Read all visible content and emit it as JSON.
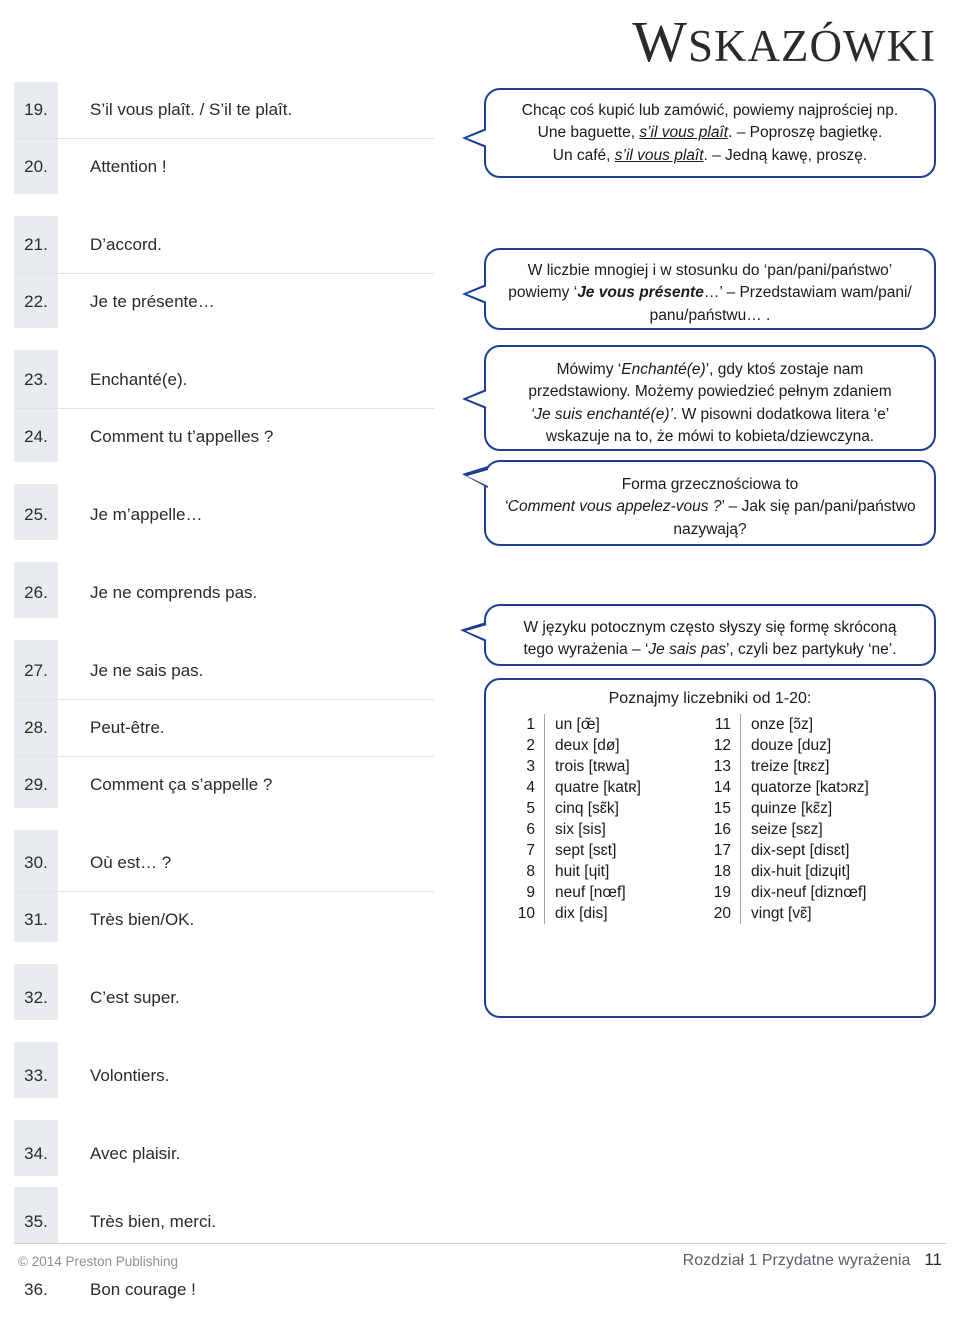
{
  "title": {
    "first_letter": "W",
    "rest": "SKAZÓWKI"
  },
  "entries": [
    {
      "num": "19.",
      "text": "S’il vous plaît. / S’il te plaît."
    },
    {
      "num": "20.",
      "text": "Attention !"
    },
    {
      "num": "21.",
      "text": "D’accord."
    },
    {
      "num": "22.",
      "text": "Je te présente…"
    },
    {
      "num": "23.",
      "text": "Enchanté(e)."
    },
    {
      "num": "24.",
      "text": "Comment tu t’appelles ?"
    },
    {
      "num": "25.",
      "text": "Je m’appelle…"
    },
    {
      "num": "26.",
      "text": "Je ne comprends pas."
    },
    {
      "num": "27.",
      "text": "Je ne sais pas."
    },
    {
      "num": "28.",
      "text": "Peut-être."
    },
    {
      "num": "29.",
      "text": "Comment ça s’appelle ?"
    },
    {
      "num": "30.",
      "text": "Où est… ?"
    },
    {
      "num": "31.",
      "text": "Très bien/OK."
    },
    {
      "num": "32.",
      "text": "C’est super."
    },
    {
      "num": "33.",
      "text": "Volontiers."
    },
    {
      "num": "34.",
      "text": "Avec plaisir."
    },
    {
      "num": "35.",
      "text": "Très bien, merci."
    },
    {
      "num": "36.",
      "text": "Bon courage !"
    }
  ],
  "callouts": {
    "c1": {
      "line1": "Chcąc coś kupić lub zamówić, powiemy najprościej np.",
      "line2_a": "Une baguette, ",
      "line2_i": "s’il vous plaît",
      "line2_b": ". – Poproszę bagietkę.",
      "line3_a": "Un café, ",
      "line3_i": "s’il vous plaît",
      "line3_b": ". – Jedną kawę, proszę."
    },
    "c2": {
      "line1": "W liczbie mnogiej i w stosunku do ‘pan/pani/państwo’",
      "line2_a": "powiemy ‘",
      "line2_i": "Je vous présente",
      "line2_b": "…’ – Przedstawiam wam/pani/",
      "line3": "panu/państwu… ."
    },
    "c3": {
      "line1_a": "Mówimy ‘",
      "line1_i": "Enchanté(e)",
      "line1_b": "’, gdy ktoś zostaje nam",
      "line2": "przedstawiony. Możemy powiedzieć pełnym zdaniem",
      "line3_i": "‘Je suis enchanté(e)’",
      "line3_b": ". W pisowni dodatkowa litera ‘e’",
      "line4": "wskazuje na to, że mówi to kobieta/dziewczyna."
    },
    "c4": {
      "line1": "Forma grzecznościowa to",
      "line2_i": "‘Comment vous appelez-vous ?",
      "line2_b": "’ – Jak się pan/pani/państwo",
      "line3": "nazywają?"
    },
    "c5": {
      "line1": "W języku potocznym często słyszy się formę skróconą",
      "line2_a": "tego wyrażenia – ‘",
      "line2_i": "Je sais pas",
      "line2_b": "’, czyli bez partykuły ‘ne’."
    }
  },
  "numbers": {
    "title": "Poznajmy liczebniki od 1-20:",
    "left": [
      {
        "idx": "1",
        "word": "un [œ̃]"
      },
      {
        "idx": "2",
        "word": "deux [dø]"
      },
      {
        "idx": "3",
        "word": "trois [tʀwa]"
      },
      {
        "idx": "4",
        "word": "quatre [katʀ]"
      },
      {
        "idx": "5",
        "word": "cinq [sɛ̃k]"
      },
      {
        "idx": "6",
        "word": "six [sis]"
      },
      {
        "idx": "7",
        "word": "sept [sɛt]"
      },
      {
        "idx": "8",
        "word": "huit [ɥit]"
      },
      {
        "idx": "9",
        "word": "neuf [nœf]"
      },
      {
        "idx": "10",
        "word": "dix [dis]"
      }
    ],
    "right": [
      {
        "idx": "11",
        "word": "onze [ɔ̃z]"
      },
      {
        "idx": "12",
        "word": "douze [duz]"
      },
      {
        "idx": "13",
        "word": "treize [tʀɛz]"
      },
      {
        "idx": "14",
        "word": "quatorze [katɔʀz]"
      },
      {
        "idx": "15",
        "word": "quinze [kɛ̃z]"
      },
      {
        "idx": "16",
        "word": "seize [sɛz]"
      },
      {
        "idx": "17",
        "word": "dix-sept [disɛt]"
      },
      {
        "idx": "18",
        "word": "dix-huit [dizɥit]"
      },
      {
        "idx": "19",
        "word": "dix-neuf [diznœf]"
      },
      {
        "idx": "20",
        "word": "vingt [vɛ̃]"
      }
    ]
  },
  "footer": {
    "copyright": "© 2014 Preston Publishing",
    "chapter": "Rozdział 1  Przydatne wyrażenia",
    "page": "11"
  },
  "colors": {
    "bubble_border": "#1c3f94",
    "shade": "#e9ecee",
    "rule": "#dfe3e6"
  }
}
